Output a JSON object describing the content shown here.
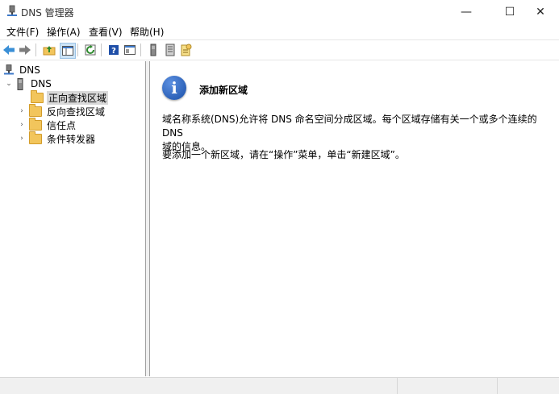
{
  "window": {
    "title": "DNS 管理器",
    "controls": {
      "minimize": "—",
      "maximize": "☐",
      "close": "✕"
    }
  },
  "menu": [
    "文件(F)",
    "操作(A)",
    "查看(V)",
    "帮助(H)"
  ],
  "toolbar": {
    "buttons": [
      "back-icon",
      "forward-icon",
      "up-folder-icon",
      "show-hide-tree-icon",
      "refresh-icon",
      "help-icon",
      "properties-icon",
      "server-icon",
      "zone-icon",
      "new-zone-icon"
    ]
  },
  "tree": {
    "root": "DNS",
    "server": "DNS",
    "children": [
      "正向查找区域",
      "反向查找区域",
      "信任点",
      "条件转发器"
    ]
  },
  "content": {
    "icon": "info-icon",
    "heading": "添加新区域",
    "para1_line1": "域名称系统(DNS)允许将 DNS 命名空间分成区域。每个区域存储有关一个或多个连续的 DNS",
    "para1_line2": "域的信息。",
    "para2": "要添加一个新区域，请在“操作”菜单，单击“新建区域”。"
  }
}
